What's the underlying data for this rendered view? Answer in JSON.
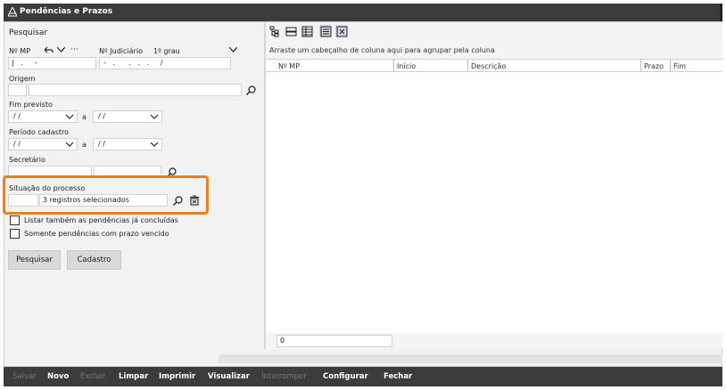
{
  "window": {
    "title": "Pendências e Prazos"
  },
  "search_panel": {
    "title": "Pesquisar",
    "mp_label": "Nº MP",
    "mp_value": "|   .     -",
    "judicial_label": "Nº Judiciário",
    "judicial_degree": "1º grau",
    "judicial_value": "-   .      .   .   .     /",
    "origem_label": "Origem",
    "fim_previsto_label": "Fim previsto",
    "date_placeholder": "/ /",
    "a_label": "a",
    "periodo_label": "Período cadastro",
    "secretario_label": "Secretário",
    "situacao_label": "Situação do processo",
    "situacao_value": "3 registros selecionados",
    "check_concluidas_label": "Listar também as pendências já concluídas",
    "check_vencido_label": "Somente pendências com prazo vencido",
    "pesquisar_button": "Pesquisar",
    "cadastro_button": "Cadastro"
  },
  "grid": {
    "group_hint": "Arraste um cabeçalho de coluna aqui para agrupar pela coluna",
    "columns": [
      "Nº MP",
      "Início",
      "Descrição",
      "Prazo",
      "Fim"
    ],
    "count": "0"
  },
  "actions": [
    "Salvar",
    "Novo",
    "Excluir",
    "Limpar",
    "Imprimir",
    "Visualizar",
    "Interromper",
    "Configurar",
    "Fechar"
  ],
  "colors": {
    "highlight": "#e8811c",
    "bar": "#3c3c3c"
  }
}
